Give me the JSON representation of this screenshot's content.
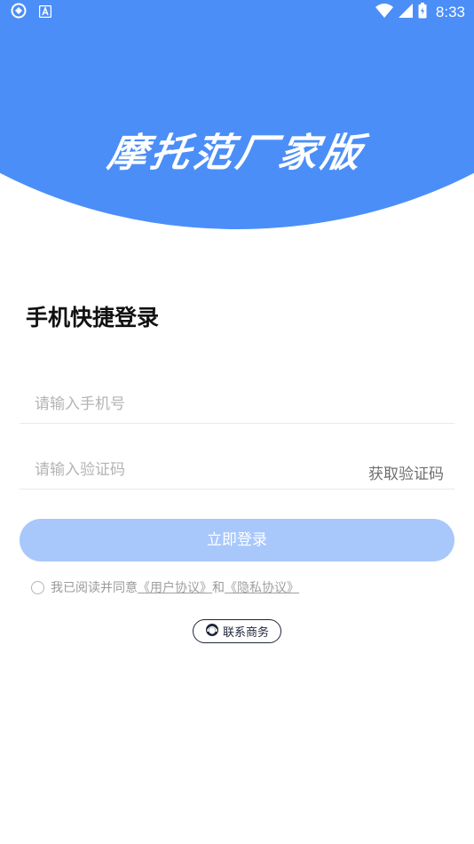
{
  "status_bar": {
    "time": "8:33",
    "left_icons": [
      "sync-icon",
      "a-app-icon"
    ],
    "right_icons": [
      "wifi-icon",
      "signal-icon",
      "battery-icon"
    ]
  },
  "header": {
    "title": "摩托范厂家版",
    "background_color": "#4b8ef8"
  },
  "login": {
    "section_title": "手机快捷登录",
    "phone_placeholder": "请输入手机号",
    "code_placeholder": "请输入验证码",
    "get_code_label": "获取验证码",
    "submit_label": "立即登录",
    "submit_color": "#a8c8fb"
  },
  "agreement": {
    "prefix": "我已阅读并同意",
    "user_agreement": "《用户协议》",
    "conjunction": "和",
    "privacy_agreement": "《隐私协议》"
  },
  "contact": {
    "label": "联系商务",
    "icon": "support-agent-icon"
  }
}
